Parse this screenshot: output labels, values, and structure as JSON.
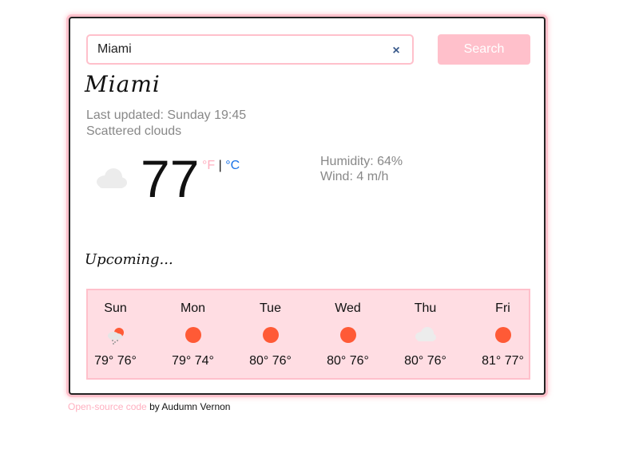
{
  "search": {
    "value": "Miami",
    "clear_label": "×",
    "button_label": "Search"
  },
  "current": {
    "city": "Miami",
    "updated": "Last updated: Sunday 19:45",
    "description": "Scattered clouds",
    "icon": "cloud-icon",
    "temperature": "77",
    "unit_f": "°F",
    "unit_sep": "|",
    "unit_c": "°C",
    "humidity": "Humidity: 64%",
    "wind": "Wind: 4 m/h"
  },
  "upcoming_label": "Upcoming...",
  "forecast": [
    {
      "day": "Sun",
      "icon": "rain-cloud-icon",
      "temps": "79° 76°"
    },
    {
      "day": "Mon",
      "icon": "sun-icon",
      "temps": "79° 74°"
    },
    {
      "day": "Tue",
      "icon": "sun-icon",
      "temps": "80° 76°"
    },
    {
      "day": "Wed",
      "icon": "sun-icon",
      "temps": "80° 76°"
    },
    {
      "day": "Thu",
      "icon": "cloud-icon",
      "temps": "80° 76°"
    },
    {
      "day": "Fri",
      "icon": "sun-icon",
      "temps": "81° 77°"
    }
  ],
  "footer": {
    "link_text": "Open-source code",
    "rest_text": " by Audumn Vernon"
  },
  "colors": {
    "accent_pink": "#ffc0cb",
    "forecast_bg": "#ffdde3",
    "celsius_blue": "#1a73e8",
    "sun": "#ff5a36"
  }
}
